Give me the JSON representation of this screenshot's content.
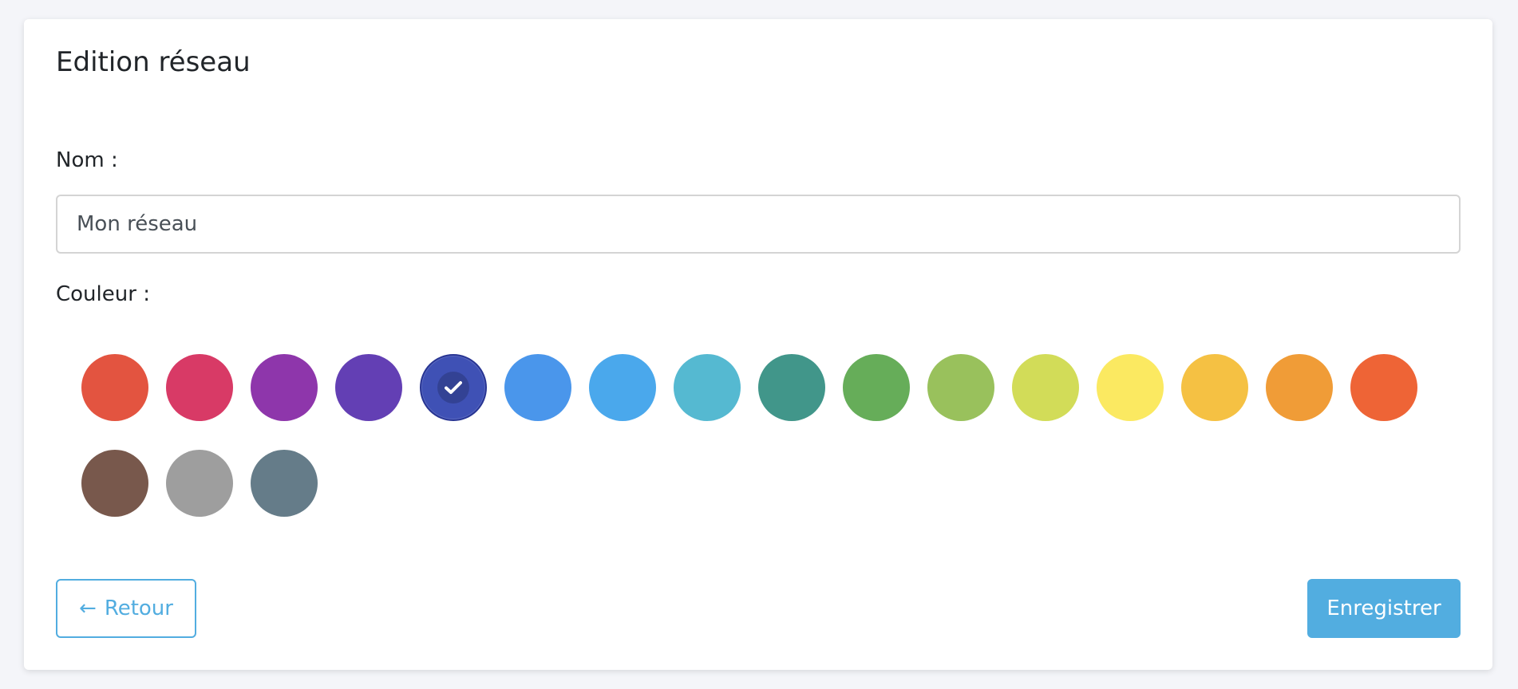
{
  "page": {
    "title": "Edition réseau"
  },
  "form": {
    "name_label": "Nom :",
    "name_value": "Mon réseau",
    "color_label": "Couleur :"
  },
  "colors": [
    {
      "name": "red",
      "hex": "#e35440",
      "selected": false
    },
    {
      "name": "pink",
      "hex": "#d83a66",
      "selected": false
    },
    {
      "name": "purple",
      "hex": "#8e36ab",
      "selected": false
    },
    {
      "name": "deep-purple",
      "hex": "#633fb4",
      "selected": false
    },
    {
      "name": "indigo",
      "hex": "#3f51b5",
      "selected": true
    },
    {
      "name": "blue",
      "hex": "#4a96eb",
      "selected": false
    },
    {
      "name": "light-blue",
      "hex": "#4aa8ec",
      "selected": false
    },
    {
      "name": "cyan",
      "hex": "#55b9d1",
      "selected": false
    },
    {
      "name": "teal",
      "hex": "#41968a",
      "selected": false
    },
    {
      "name": "green",
      "hex": "#66ad59",
      "selected": false
    },
    {
      "name": "light-green",
      "hex": "#99c15c",
      "selected": false
    },
    {
      "name": "lime",
      "hex": "#d2dc58",
      "selected": false
    },
    {
      "name": "yellow",
      "hex": "#fbe961",
      "selected": false
    },
    {
      "name": "amber",
      "hex": "#f5c143",
      "selected": false
    },
    {
      "name": "orange",
      "hex": "#f09c37",
      "selected": false
    },
    {
      "name": "deep-orange",
      "hex": "#ee6436",
      "selected": false
    },
    {
      "name": "brown",
      "hex": "#78584c",
      "selected": false
    },
    {
      "name": "grey",
      "hex": "#9e9e9e",
      "selected": false
    },
    {
      "name": "blue-grey",
      "hex": "#657c89",
      "selected": false
    }
  ],
  "actions": {
    "back_label": "Retour",
    "back_icon": "arrow-left-icon",
    "save_label": "Enregistrer"
  },
  "theme": {
    "accent": "#52ade0",
    "selected_check_icon": "check-icon"
  }
}
